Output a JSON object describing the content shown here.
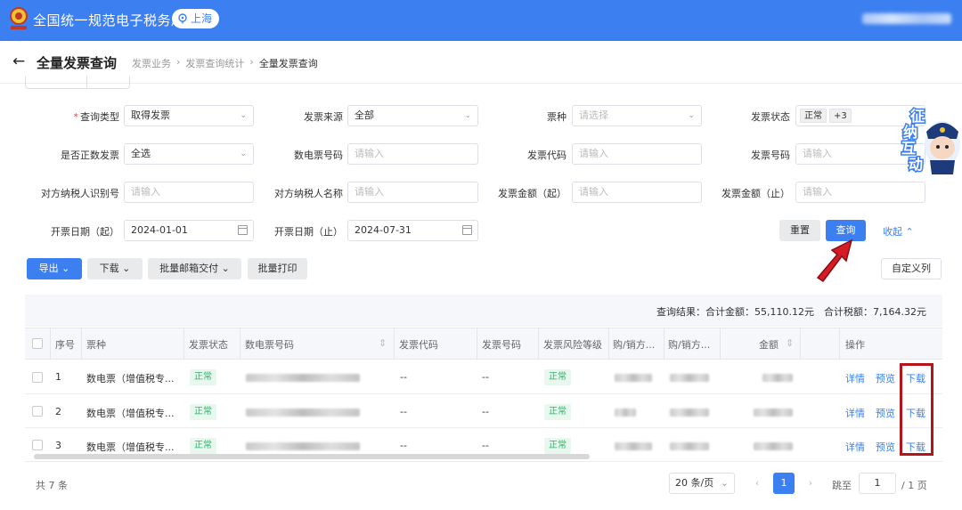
{
  "header": {
    "title": "全国统一规范电子税务局",
    "region": "上海"
  },
  "page": {
    "title": "全量发票查询",
    "breadcrumb": [
      "发票业务",
      "发票查询统计",
      "全量发票查询"
    ]
  },
  "filters": {
    "query_type": {
      "label": "查询类型",
      "value": "取得发票"
    },
    "invoice_source": {
      "label": "发票来源",
      "value": "全部"
    },
    "ticket_type": {
      "label": "票种",
      "placeholder": "请选择"
    },
    "invoice_status": {
      "label": "发票状态",
      "tags": [
        "正常",
        "+3"
      ]
    },
    "is_positive": {
      "label": "是否正数发票",
      "value": "全选"
    },
    "e_invoice_no": {
      "label": "数电票号码",
      "placeholder": "请输入"
    },
    "invoice_code": {
      "label": "发票代码",
      "placeholder": "请输入"
    },
    "invoice_no": {
      "label": "发票号码",
      "placeholder": "请输入"
    },
    "counterparty_id": {
      "label": "对方纳税人识别号",
      "placeholder": "请输入"
    },
    "counterparty_name": {
      "label": "对方纳税人名称",
      "placeholder": "请输入"
    },
    "amount_from": {
      "label": "发票金额（起）",
      "placeholder": "请输入"
    },
    "amount_to": {
      "label": "发票金额（止）",
      "placeholder": "请输入"
    },
    "date_from": {
      "label": "开票日期（起）",
      "value": "2024-01-01"
    },
    "date_to": {
      "label": "开票日期（止）",
      "value": "2024-07-31"
    },
    "reset": "重置",
    "query": "查询",
    "collapse": "收起"
  },
  "toolbar": {
    "export": "导出",
    "download": "下载",
    "batch_email": "批量邮箱交付",
    "batch_print": "批量打印",
    "custom_columns": "自定义列"
  },
  "summary": "查询结果：合计金额：55,110.12元　合计税额：7,164.32元",
  "table": {
    "columns": [
      "序号",
      "票种",
      "发票状态",
      "数电票号码",
      "发票代码",
      "发票号码",
      "发票风险等级",
      "购/销方...",
      "购/销方...",
      "金额",
      "操作"
    ],
    "rows": [
      {
        "no": "1",
        "type": "数电票（增值税专...",
        "status": "正常",
        "code": "--",
        "number": "--",
        "risk": "正常"
      },
      {
        "no": "2",
        "type": "数电票（增值税专...",
        "status": "正常",
        "code": "--",
        "number": "--",
        "risk": "正常"
      },
      {
        "no": "3",
        "type": "数电票（增值税专...",
        "status": "正常",
        "code": "--",
        "number": "--",
        "risk": "正常"
      }
    ],
    "actions": {
      "detail": "详情",
      "preview": "预览",
      "download": "下载"
    }
  },
  "pagination": {
    "total": "共 7 条",
    "page_size": "20 条/页",
    "current": "1",
    "jump_label": "跳至",
    "jump_value": "1",
    "pages": "/ 1 页"
  },
  "mascot_text": [
    "征",
    "纳",
    "互",
    "动"
  ],
  "colors": {
    "primary": "#3b7ff0",
    "highlight": "#b3151b",
    "status_green": "#2fb26b"
  }
}
